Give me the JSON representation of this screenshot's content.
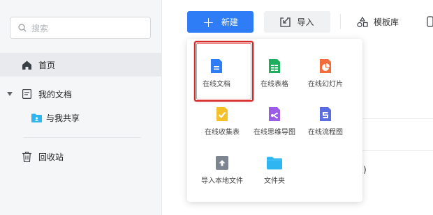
{
  "sidebar": {
    "search_placeholder": "搜索",
    "items": [
      {
        "label": "首页"
      },
      {
        "label": "我的文档"
      },
      {
        "label": "与我共享"
      },
      {
        "label": "回收站"
      }
    ]
  },
  "toolbar": {
    "new_label": "新建",
    "import_label": "导入",
    "template_label": "模板库"
  },
  "background": {
    "partial_text": "版)"
  },
  "new_menu": {
    "items": [
      {
        "label": "在线文档",
        "icon": "doc-icon",
        "color": "#2e7cf6"
      },
      {
        "label": "在线表格",
        "icon": "sheet-icon",
        "color": "#1fae5e"
      },
      {
        "label": "在线幻灯片",
        "icon": "slides-icon",
        "color": "#f26c3c"
      },
      {
        "label": "在线收集表",
        "icon": "form-icon",
        "color": "#f6c02b"
      },
      {
        "label": "在线思维导图",
        "icon": "mindmap-icon",
        "color": "#9b5de5"
      },
      {
        "label": "在线流程图",
        "icon": "flowchart-icon",
        "color": "#5b6ee1"
      },
      {
        "label": "导入本地文件",
        "icon": "upload-icon",
        "color": "#7d8590"
      },
      {
        "label": "文件夹",
        "icon": "folder-icon",
        "color": "#2fb6f0"
      }
    ]
  }
}
